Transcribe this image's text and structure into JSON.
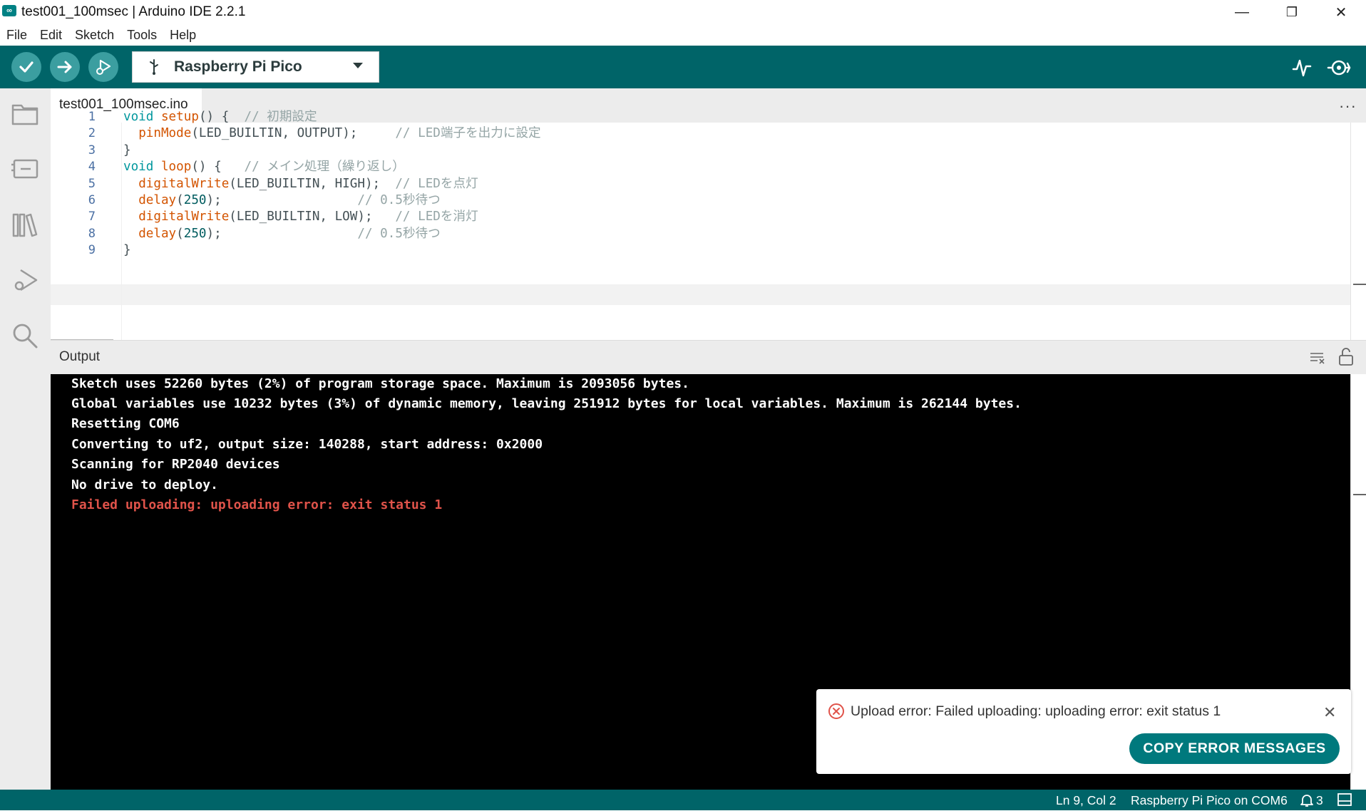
{
  "window": {
    "logo_text": "∞",
    "title": "test001_100msec | Arduino IDE 2.2.1",
    "minimize": "—",
    "restore": "❐",
    "close": "✕"
  },
  "menu": [
    "File",
    "Edit",
    "Sketch",
    "Tools",
    "Help"
  ],
  "toolbar": {
    "board": "Raspberry Pi Pico",
    "icons": [
      "verify-icon",
      "upload-icon",
      "debug-icon",
      "usb-icon",
      "serial-plotter-icon",
      "serial-monitor-icon"
    ]
  },
  "sidebar": [
    "sketchbook-icon",
    "boards-manager-icon",
    "library-manager-icon",
    "debug-icon",
    "search-icon"
  ],
  "editor": {
    "tab": "test001_100msec.ino",
    "more": "···",
    "lines": [
      {
        "n": "1",
        "parts": [
          [
            "kw",
            "void "
          ],
          [
            "fn",
            "setup"
          ],
          [
            "",
            "() {  "
          ],
          [
            "cm",
            "// 初期設定"
          ]
        ]
      },
      {
        "n": "2",
        "parts": [
          [
            "",
            "  "
          ],
          [
            "fn",
            "pinMode"
          ],
          [
            "",
            "(LED_BUILTIN, OUTPUT);     "
          ],
          [
            "cm",
            "// LED端子を出力に設定"
          ]
        ]
      },
      {
        "n": "3",
        "parts": [
          [
            "",
            "}"
          ]
        ]
      },
      {
        "n": "4",
        "parts": [
          [
            "kw",
            "void "
          ],
          [
            "fn",
            "loop"
          ],
          [
            "",
            "() {   "
          ],
          [
            "cm",
            "// メイン処理（繰り返し）"
          ]
        ]
      },
      {
        "n": "5",
        "parts": [
          [
            "",
            "  "
          ],
          [
            "fn",
            "digitalWrite"
          ],
          [
            "",
            "(LED_BUILTIN, HIGH);  "
          ],
          [
            "cm",
            "// LEDを点灯"
          ]
        ]
      },
      {
        "n": "6",
        "parts": [
          [
            "",
            "  "
          ],
          [
            "fn",
            "delay"
          ],
          [
            "",
            "("
          ],
          [
            "num",
            "250"
          ],
          [
            "",
            ");                  "
          ],
          [
            "cm",
            "// 0.5秒待つ"
          ]
        ]
      },
      {
        "n": "7",
        "parts": [
          [
            "",
            "  "
          ],
          [
            "fn",
            "digitalWrite"
          ],
          [
            "",
            "(LED_BUILTIN, LOW);   "
          ],
          [
            "cm",
            "// LEDを消灯"
          ]
        ]
      },
      {
        "n": "8",
        "parts": [
          [
            "",
            "  "
          ],
          [
            "fn",
            "delay"
          ],
          [
            "",
            "("
          ],
          [
            "num",
            "250"
          ],
          [
            "",
            ");                  "
          ],
          [
            "cm",
            "// 0.5秒待つ"
          ]
        ]
      },
      {
        "n": "9",
        "parts": [
          [
            "",
            "}"
          ]
        ]
      }
    ]
  },
  "output": {
    "title": "Output",
    "lines": [
      "Sketch uses 52260 bytes (2%) of program storage space. Maximum is 2093056 bytes.",
      "Global variables use 10232 bytes (3%) of dynamic memory, leaving 251912 bytes for local variables. Maximum is 262144 bytes.",
      "Resetting COM6",
      "Converting to uf2, output size: 140288, start address: 0x2000",
      "Scanning for RP2040 devices",
      "No drive to deploy."
    ],
    "error_line": "Failed uploading: uploading error: exit status 1"
  },
  "notification": {
    "message": "Upload error: Failed uploading: uploading error: exit status 1",
    "close": "✕",
    "button": "COPY ERROR MESSAGES"
  },
  "status": {
    "position": "Ln 9, Col 2",
    "board_port": "Raspberry Pi Pico on COM6",
    "notifications": "3"
  },
  "colors": {
    "teal_dark": "#006468",
    "teal_button": "#00797d",
    "error": "#e0534a"
  }
}
